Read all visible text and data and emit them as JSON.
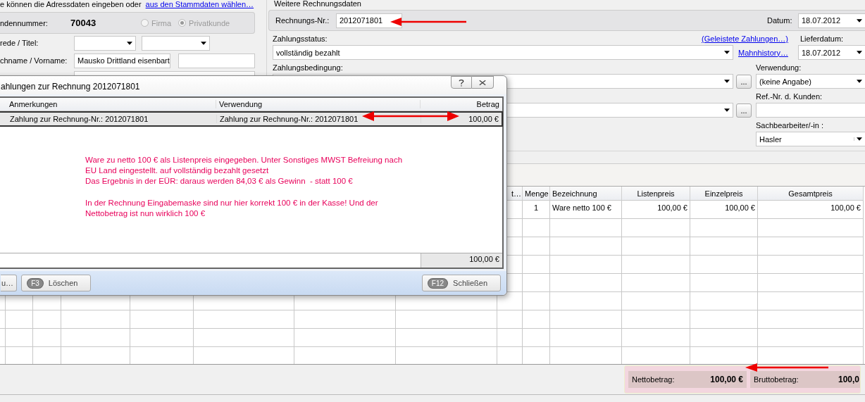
{
  "address_panel": {
    "intro": "e können die Adressdaten eingeben oder",
    "intro_link": "aus den Stammdaten wählen…",
    "customer_number_label": "ndennummer:",
    "customer_number": "70043",
    "customer_type": [
      {
        "label": "Firma",
        "selected": false
      },
      {
        "label": "Privatkunde",
        "selected": true
      }
    ],
    "salutation_label": "rede / Titel:",
    "name_label": "chname / Vorname:",
    "last_name": "Mausko Drittland eisenbart"
  },
  "invoice_panel": {
    "title": "Weitere Rechnungsdaten",
    "invoice_number_label": "Rechnungs-Nr.:",
    "invoice_number": "2012071801",
    "date_label": "Datum:",
    "date": "18.07.2012",
    "payment_status_label": "Zahlungsstatus:",
    "payments_link": "(Geleistete Zahlungen…)",
    "payment_status": "vollständig bezahlt",
    "dunning_link": "Mahnhistory…",
    "delivery_date_label": "Lieferdatum:",
    "delivery_date": "18.07.2012",
    "payment_terms_label": "Zahlungsbedingung:",
    "usage_label": "Verwendung:",
    "usage": "(keine Angabe)",
    "customer_ref_label": "Ref.-Nr. d. Kunden:",
    "clerk_label": "Sachbearbeiter/-in :",
    "clerk": "Hasler",
    "more_button": "..."
  },
  "items_table": {
    "columns": [
      "t…",
      "Menge",
      "Bezeichnung",
      "Listenpreis",
      "Einzelpreis",
      "Gesamtpreis"
    ],
    "rows": [
      {
        "menge": "1",
        "bezeichnung": "Ware netto 100 €",
        "listenpreis": "100,00 €",
        "einzelpreis": "100,00 €",
        "gesamtpreis": "100,00 €"
      }
    ]
  },
  "totals": [
    {
      "label": "Nettobetrag:",
      "value": "100,00 €"
    },
    {
      "label": "Bruttobetrag:",
      "value": "100,0"
    }
  ],
  "payments_dialog": {
    "title": "ahlungen zur Rechnung 2012071801",
    "columns": [
      "Anmerkungen",
      "Verwendung",
      "Betrag"
    ],
    "rows": [
      {
        "anmerkungen": "Zahlung zur Rechnung-Nr.: 2012071801",
        "verwendung": "Zahlung zur Rechnung-Nr.: 2012071801",
        "betrag": "100,00 €",
        "selected": true
      }
    ],
    "note": [
      "Ware zu netto 100 € als Listenpreis eingegeben. Unter Sonstiges MWST Befreiung nach\nEU Land eingestellt. auf vollständig bezahlt gesetzt\nDas Ergebnis in der EÜR: daraus werden 84,03 € als Gewinn  - statt 100 €",
      "In der Rechnung Eingabemaske sind nur hier korrekt 100 € in der Kasse! Und der\nNettobetrag ist nun wirklich 100 €"
    ],
    "sum": "100,00 €",
    "buttons": [
      {
        "label": "u…"
      },
      {
        "key": "F3",
        "label": "Löschen"
      },
      {
        "key": "F12",
        "label": "Schließen"
      }
    ]
  }
}
